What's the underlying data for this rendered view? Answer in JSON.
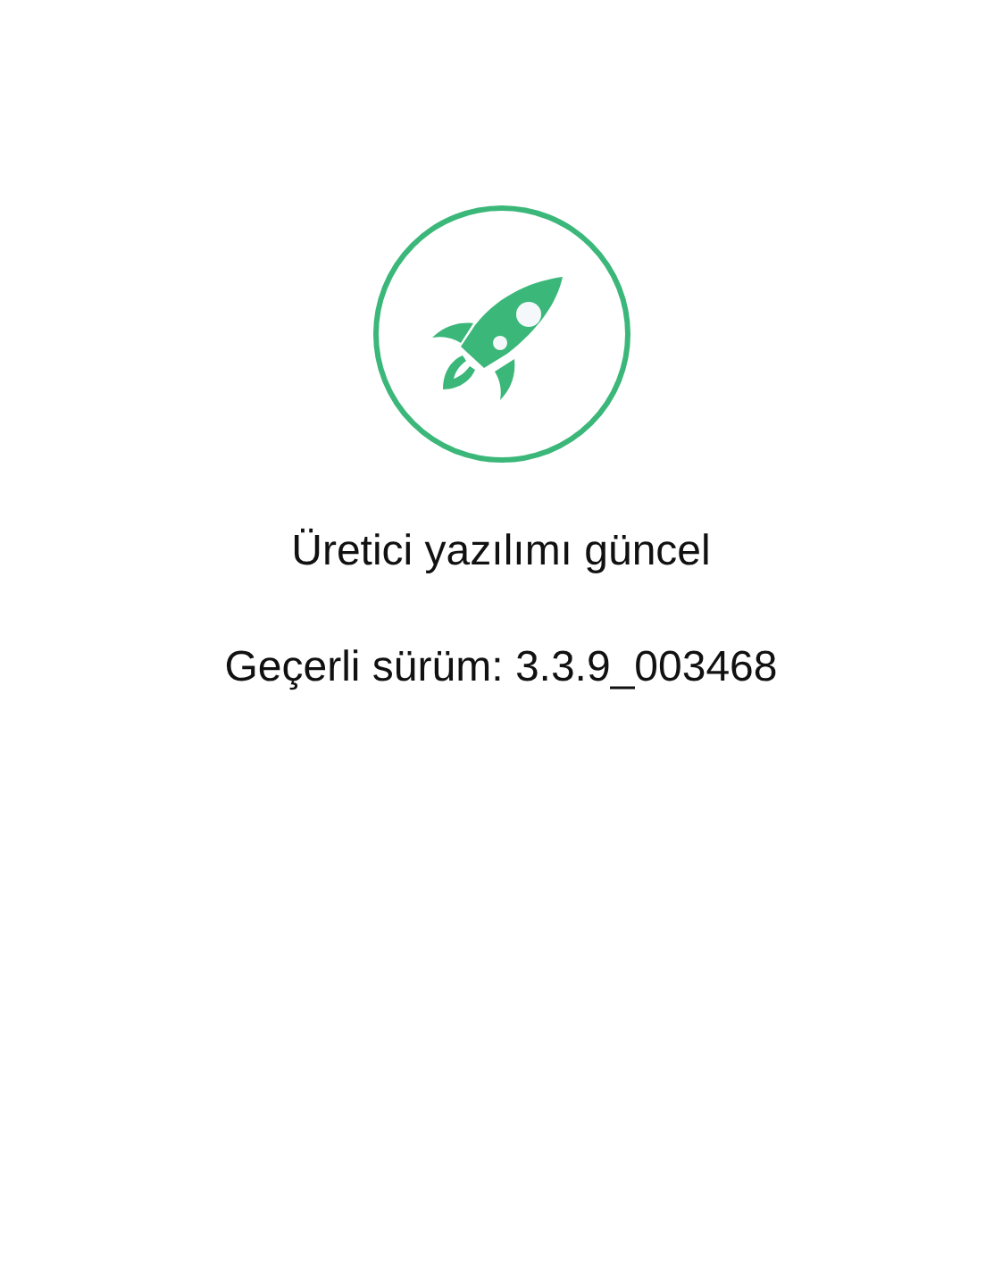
{
  "status": {
    "title": "Üretici yazılımı güncel",
    "version": "Geçerli sürüm: 3.3.9_003468"
  }
}
